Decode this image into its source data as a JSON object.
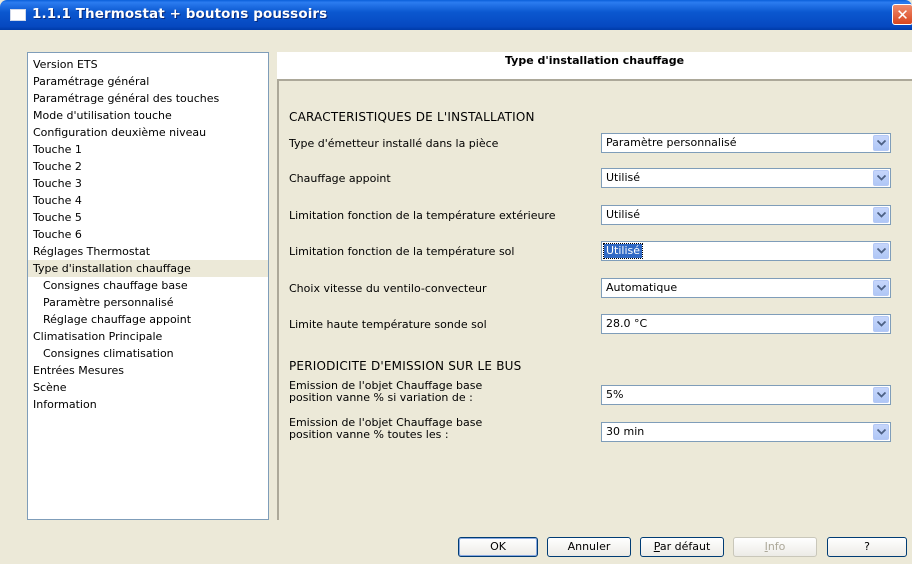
{
  "window": {
    "title": "1.1.1 Thermostat + boutons poussoirs",
    "close_label": "✕"
  },
  "tree": [
    {
      "label": "Version ETS",
      "sub": false,
      "selected": false
    },
    {
      "label": "Paramétrage général",
      "sub": false,
      "selected": false
    },
    {
      "label": "Paramétrage général des touches",
      "sub": false,
      "selected": false
    },
    {
      "label": "Mode d'utilisation touche",
      "sub": false,
      "selected": false
    },
    {
      "label": "Configuration deuxième niveau",
      "sub": false,
      "selected": false
    },
    {
      "label": "Touche 1",
      "sub": false,
      "selected": false
    },
    {
      "label": "Touche 2",
      "sub": false,
      "selected": false
    },
    {
      "label": "Touche 3",
      "sub": false,
      "selected": false
    },
    {
      "label": "Touche 4",
      "sub": false,
      "selected": false
    },
    {
      "label": "Touche 5",
      "sub": false,
      "selected": false
    },
    {
      "label": "Touche 6",
      "sub": false,
      "selected": false
    },
    {
      "label": "Réglages Thermostat",
      "sub": false,
      "selected": false
    },
    {
      "label": "Type d'installation chauffage",
      "sub": false,
      "selected": true
    },
    {
      "label": "Consignes chauffage base",
      "sub": true,
      "selected": false
    },
    {
      "label": "Paramètre personnalisé",
      "sub": true,
      "selected": false
    },
    {
      "label": "Réglage chauffage appoint",
      "sub": true,
      "selected": false
    },
    {
      "label": "Climatisation Principale",
      "sub": false,
      "selected": false
    },
    {
      "label": "Consignes climatisation",
      "sub": true,
      "selected": false
    },
    {
      "label": "Entrées Mesures",
      "sub": false,
      "selected": false
    },
    {
      "label": "Scène",
      "sub": false,
      "selected": false
    },
    {
      "label": "Information",
      "sub": false,
      "selected": false
    }
  ],
  "panel": {
    "header": "Type d'installation chauffage",
    "section1": "CARACTERISTIQUES DE L'INSTALLATION",
    "section2": "PERIODICITE D'EMISSION SUR LE BUS",
    "rows": [
      {
        "label": "Type d'émetteur installé dans la pièce",
        "value": "Paramètre personnalisé",
        "focused": false
      },
      {
        "label": "Chauffage appoint",
        "value": "Utilisé",
        "focused": false
      },
      {
        "label": "Limitation fonction de la température extérieure",
        "value": "Utilisé",
        "focused": false
      },
      {
        "label": "Limitation fonction de la température sol",
        "value": "Utilisé",
        "focused": true
      },
      {
        "label": "Choix vitesse du ventilo-convecteur",
        "value": "Automatique",
        "focused": false
      },
      {
        "label": "Limite haute température sonde sol",
        "value": "28.0 °C",
        "focused": false
      }
    ],
    "rows2": [
      {
        "label1": "Emission de l'objet Chauffage base",
        "label2": "position vanne % si variation de :",
        "value": "5%"
      },
      {
        "label1": "Emission de l'objet Chauffage base",
        "label2": "position vanne % toutes les :",
        "value": "30 min"
      }
    ]
  },
  "buttons": {
    "ok": "OK",
    "cancel": "Annuler",
    "default_pre": "P",
    "default_post": "ar défaut",
    "info_pre": "I",
    "info_post": "nfo",
    "help": "?"
  }
}
